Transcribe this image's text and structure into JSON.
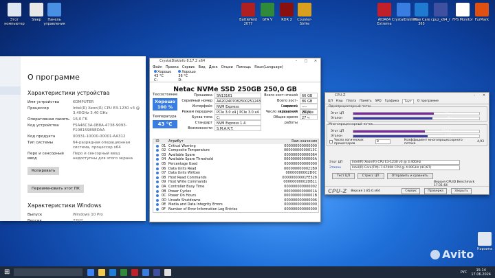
{
  "desktop": {
    "icons": [
      {
        "label": "Этот компьютер",
        "color": "#dfe8f2"
      },
      {
        "label": "Sleep",
        "color": "#e8e8e8"
      },
      {
        "label": "Панель управления",
        "color": "#4a90e2"
      },
      {
        "label": "Battlefield 2077",
        "color": "#b02020"
      },
      {
        "label": "GTA V",
        "color": "#2f8a3a"
      },
      {
        "label": "RDR 2",
        "color": "#8a1010"
      },
      {
        "label": "Counter-Strike",
        "color": "#d9a020"
      },
      {
        "label": "AIDA64 Extreme",
        "color": "#c0202a"
      },
      {
        "label": "CrystalDiskInfo",
        "color": "#3a7de0"
      },
      {
        "label": "Wise Care 365",
        "color": "#1f7ad0"
      },
      {
        "label": "cpuz_x64_r",
        "color": "#4050a0"
      },
      {
        "label": "FPS Monitor",
        "color": "#ffffff"
      },
      {
        "label": "FurMark",
        "color": "#e05010"
      },
      {
        "label": "Корзина",
        "color": "#dfe8f2"
      }
    ]
  },
  "settings": {
    "title": "О программе",
    "device_heading": "Характеристики устройства",
    "specs": [
      {
        "k": "Имя устройства",
        "v": "KOMPUTER"
      },
      {
        "k": "Процессор",
        "v": "Intel(R) Xeon(R) CPU E3-1230 v3 @ 3.40GHz   3.40 GHz"
      },
      {
        "k": "Оперативная память",
        "v": "16,0 ГБ"
      },
      {
        "k": "Код устройства",
        "v": "F5A46C3A-0B8A-4738-9093-F10815989EDAA"
      },
      {
        "k": "Код продукта",
        "v": "00331-10000-00001-AA312"
      },
      {
        "k": "Тип системы",
        "v": "64-разрядная операционная система, процессор x64"
      },
      {
        "k": "Перо и сенсорный ввод",
        "v": "Перо и сенсорный ввод недоступны для этого экрана"
      }
    ],
    "copy_button": "Копировать",
    "rename_button": "Переименовать этот ПК",
    "windows_heading": "Характеристики Windows",
    "win_specs": [
      {
        "k": "Выпуск",
        "v": "Windows 10 Pro"
      },
      {
        "k": "Версия",
        "v": "22H2"
      }
    ]
  },
  "crystal": {
    "title": "CrystalDiskInfo 8.17.2 x64",
    "menu": [
      "Файл",
      "Правка",
      "Сервис",
      "Вид",
      "Диск",
      "Опции",
      "Помощь",
      "Язык(Language)"
    ],
    "drives": [
      {
        "status": "Хорошо",
        "temp": "43 °C",
        "letter": "C:"
      },
      {
        "status": "Хорошо",
        "temp": "36 °C",
        "letter": "D:"
      }
    ],
    "disk_title": "Netac NVMe SSD 250GB 250,0 GB",
    "tech_label": "Техсостояние",
    "health_text": "Хорошо",
    "health_pct": "100 %",
    "temp_label": "Температура",
    "temp_value": "43 °C",
    "left_fields": [
      {
        "k": "Прошивка",
        "v": "SN13161"
      },
      {
        "k": "Серийный номер",
        "v": "AA202407082500251243"
      },
      {
        "k": "Интерфейс",
        "v": "NVM Express"
      },
      {
        "k": "Режим передачи",
        "v": "PCIe 3.0 x4 | PCIe 3.0 x4"
      },
      {
        "k": "Буква тома",
        "v": "C:"
      },
      {
        "k": "Стандарт",
        "v": "NVM Express 1.4"
      },
      {
        "k": "Возможности",
        "v": "S.M.A.R.T."
      }
    ],
    "right_fields": [
      {
        "k": "Всего хост-чтений",
        "v": "66 GB"
      },
      {
        "k": "Всего хост-записей",
        "v": "86 GB"
      },
      {
        "k": "Скорость вращения",
        "v": "---- (SSD)"
      },
      {
        "k": "Число включений",
        "v": "26 раз"
      },
      {
        "k": "Общее время работы",
        "v": "27 ч"
      }
    ],
    "table_head": [
      "ID",
      "Атрибут",
      "Raw-значения"
    ],
    "rows": [
      {
        "id": "01",
        "name": "Critical Warning",
        "raw": "000000000000000"
      },
      {
        "id": "02",
        "name": "Composite Temperature",
        "raw": "00000000000013C"
      },
      {
        "id": "03",
        "name": "Available Spare",
        "raw": "000000000000064"
      },
      {
        "id": "04",
        "name": "Available Spare Threshold",
        "raw": "00000000000000A"
      },
      {
        "id": "05",
        "name": "Percentage Used",
        "raw": "000000000000000"
      },
      {
        "id": "06",
        "name": "Data Units Read",
        "raw": "0000000000021B9"
      },
      {
        "id": "07",
        "name": "Data Units Written",
        "raw": "00000000002D0C"
      },
      {
        "id": "08",
        "name": "Host Read Commands",
        "raw": "00000000001FE528"
      },
      {
        "id": "09",
        "name": "Host Write Commands",
        "raw": "00000000002DB11"
      },
      {
        "id": "0A",
        "name": "Controller Busy Time",
        "raw": "000000000000002"
      },
      {
        "id": "0B",
        "name": "Power Cycles",
        "raw": "00000000000001A"
      },
      {
        "id": "0C",
        "name": "Power On Hours",
        "raw": "00000000000001B"
      },
      {
        "id": "0D",
        "name": "Unsafe Shutdowns",
        "raw": "000000000000006"
      },
      {
        "id": "0E",
        "name": "Media and Data Integrity Errors",
        "raw": "000000000000000"
      },
      {
        "id": "0F",
        "name": "Number of Error Information Log Entries",
        "raw": "000000000000000"
      }
    ]
  },
  "cpuz": {
    "title": "CPU-Z",
    "tabs": [
      "ЦП",
      "Кэш",
      "Плата",
      "Память",
      "SPD",
      "Графика",
      "Тест",
      "О программе"
    ],
    "active_tab": "Тест",
    "single_label": "Однопроцессорный поток",
    "this_cpu": "Этот ЦП",
    "etalon": "Эталон",
    "single_this": "481,4",
    "single_ref": "474",
    "multi_label": "Многопроцессорный поток",
    "multi_this": "2187,1",
    "multi_ref": "2273",
    "threads_label": "Число логических процессоров",
    "threads_value": "8",
    "ratio_label": "Коэффициент многопроцессорного потока",
    "ratio_value": "4,93",
    "this_cpu_field": "Этот ЦП",
    "this_cpu_name": "Intel(R) Xeon(R) CPU E3-1230 v3 @ 3.40GHz",
    "etalon_name": "Intel(R) Core(TM) i7-6700K CPU @ 4.00GHz (4C/8T)",
    "btn_test": "Тест ЦП",
    "btn_stress": "Стресс ЦП",
    "btn_submit": "Отправить и сравнить",
    "version_label": "Версия CPUID Benchmark 17.01.64",
    "bottom_logo": "CPU-Z",
    "bottom_ver": "Версия 1.85.0.x64",
    "btn_service": "Сервис",
    "btn_verify": "Проверка",
    "btn_close": "Закрыть",
    "single_frac_this": 0.64,
    "single_frac_ref": 0.63,
    "multi_frac_this": 0.57,
    "multi_frac_ref": 0.59,
    "color_this": "#7a2a9a",
    "color_ref": "#3a3aa0"
  },
  "taskbar": {
    "clock": "15:14",
    "date": "17.06.2024",
    "lang": "РУС",
    "watermark": "Avito"
  }
}
